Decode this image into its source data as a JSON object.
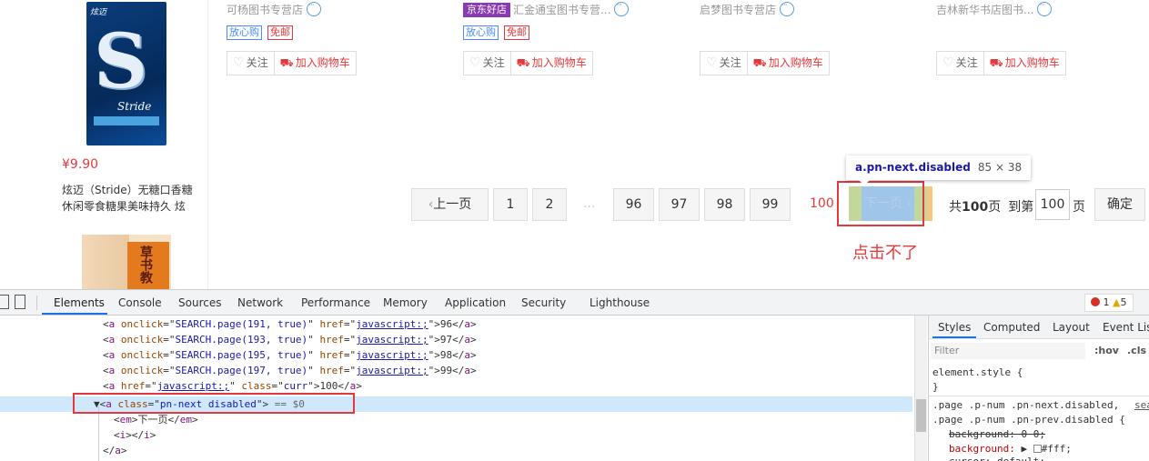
{
  "products": {
    "shops": [
      "可杨图书专营店",
      "汇金通宝图书专营...",
      "启梦图书专营店",
      "吉林新华书店图书..."
    ],
    "jd_badge": "京东好店",
    "tags": {
      "fangxin": "放心购",
      "mianyou": "免邮"
    },
    "actions": {
      "follow": "关注",
      "add_cart": "加入购物车"
    },
    "gum": {
      "brand_cn": "炫迈",
      "brand_en": "Stride",
      "price": "¥9.90",
      "name_line1": "炫迈（Stride）无糖口香糖",
      "name_line2": "休闲零食糖果美味持久 炫"
    },
    "book": {
      "title": "草书教"
    }
  },
  "pagination": {
    "prev": "上一页",
    "pages": [
      "1",
      "2",
      "96",
      "97",
      "98",
      "99"
    ],
    "ellipsis": "...",
    "current": "100",
    "next": "下一页",
    "total_prefix": "共",
    "total_pages": "100",
    "total_suffix": "页",
    "goto_label": "到第",
    "goto_value": "100",
    "goto_unit": "页",
    "confirm": "确定"
  },
  "inspector_tooltip": {
    "selector": "a.pn-next.disabled",
    "size": "85 × 38"
  },
  "annotation": "点击不了",
  "devtools": {
    "tabs": [
      "Elements",
      "Console",
      "Sources",
      "Network",
      "Performance",
      "Memory",
      "Application",
      "Security",
      "Lighthouse"
    ],
    "errors": "1",
    "warnings": "5",
    "code_lines": [
      {
        "onclick": "SEARCH.page(191, true)",
        "href": "javascript:;",
        "text": "96"
      },
      {
        "onclick": "SEARCH.page(193, true)",
        "href": "javascript:;",
        "text": "97"
      },
      {
        "onclick": "SEARCH.page(195, true)",
        "href": "javascript:;",
        "text": "98"
      },
      {
        "onclick": "SEARCH.page(197, true)",
        "href": "javascript:;",
        "text": "99"
      }
    ],
    "curr_line": {
      "href": "javascript:;",
      "class": "curr",
      "text": "100"
    },
    "selected_line": {
      "class": "pn-next disabled",
      "suffix": "== $0"
    },
    "em_text": "下一页",
    "side_tabs": [
      "Styles",
      "Computed",
      "Layout",
      "Event Listen"
    ],
    "filter_placeholder": "Filter",
    "hov": ":hov",
    "cls": ".cls",
    "element_style": "element.style {",
    "close_brace": "}",
    "rule_selector1": ".page .p-num .pn-next.disabled,",
    "rule_selector2": ".page .p-num .pn-prev.disabled {",
    "rule_source": "sea",
    "prop_bg_struck": "background: 0 0;",
    "prop_bg": "background:",
    "prop_bg_value": "#fff;",
    "prop_cursor": "cursor: default;"
  }
}
